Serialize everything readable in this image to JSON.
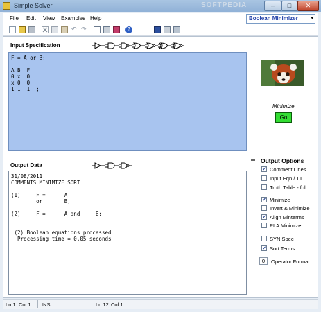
{
  "window": {
    "title": "Simple Solver",
    "watermark": "SOFTPEDIA"
  },
  "titlebar_buttons": {
    "minimize": "–",
    "maximize": "□",
    "close": "✕"
  },
  "menu": {
    "items": [
      "File",
      "Edit",
      "View",
      "Examples",
      "Help"
    ]
  },
  "mode_select": {
    "value": "Boolean Minimizer",
    "arrow": "▾"
  },
  "toolbar": {
    "icons": [
      "new-icon",
      "open-icon",
      "save-icon",
      "cut-icon",
      "copy-icon",
      "paste-icon",
      "undo-icon",
      "redo-icon",
      "print-preview-icon",
      "print-icon",
      "page-setup-icon",
      "help-icon",
      "save-output-icon",
      "print-output-icon",
      "print-setup-output-icon"
    ]
  },
  "input": {
    "label": "Input Specification",
    "text": "F = A or B;\n\nA B  F\n0 x  0\nx 0  0\n1 1  1  ;"
  },
  "output": {
    "label": "Output Data",
    "text": "31/08/2011\nCOMMENTS MINIMIZE SORT\n\n(1)     F =      A\n        or       B;\n\n(2)     F =      A and     B;\n\n\n (2) Boolean equations processed\n  Processing time = 0.05 seconds"
  },
  "minimize": {
    "label": "Minimize",
    "go": "Go"
  },
  "options": {
    "title": "Output Options",
    "items": [
      {
        "label": "Comment Lines",
        "checked": true
      },
      {
        "label": "Input Eqn / TT",
        "checked": false
      },
      {
        "label": "Truth Table - full",
        "checked": false
      },
      {
        "label": "Minimize",
        "checked": true
      },
      {
        "label": "Invert & Minimize",
        "checked": false
      },
      {
        "label": "Align Minterms",
        "checked": true
      },
      {
        "label": "PLA Minimize",
        "checked": false
      },
      {
        "label": "SYN Spec",
        "checked": false
      },
      {
        "label": "Sort Terms",
        "checked": true
      }
    ],
    "operator_format_value": "0",
    "operator_format_label": "Operator Format"
  },
  "status": {
    "ln1": "Ln 1",
    "col1": "Col 1",
    "ins": "INS",
    "ln2": "Ln 12",
    "col2": "Col 1"
  },
  "colors": {
    "input_bg": "#a8c4ef",
    "go_button": "#33dd33",
    "mode_text": "#1f3fa8"
  }
}
